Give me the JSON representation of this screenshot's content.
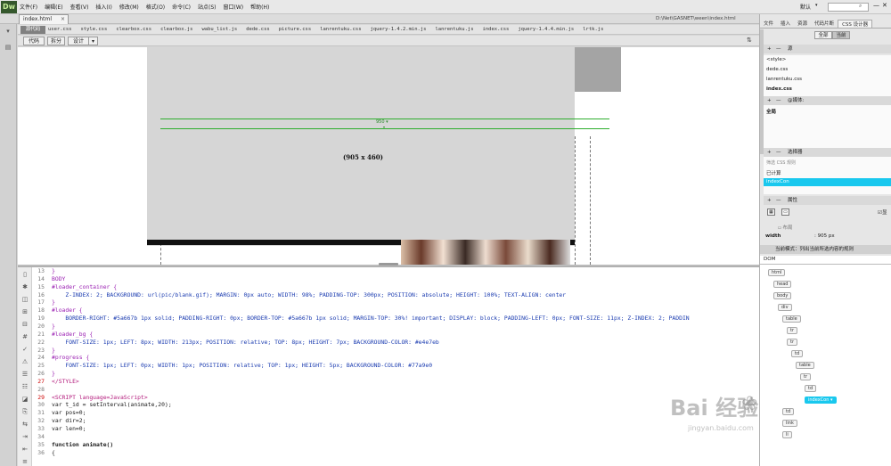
{
  "app": {
    "logo": "Dw",
    "menu": [
      "文件(F)",
      "编辑(E)",
      "查看(V)",
      "插入(I)",
      "修改(M)",
      "格式(O)",
      "命令(C)",
      "站点(S)",
      "窗口(W)",
      "帮助(H)"
    ],
    "workspace": "默认",
    "minimize": "—",
    "close": "✕"
  },
  "document": {
    "tab_name": "index.html",
    "tab_close": "×",
    "path": "D:\\Net\\GASNET\\ween\\index.html",
    "source_code_tab": "源代码",
    "related_files": [
      "user.css",
      "style.css",
      "clearbox.css",
      "clearbox.js",
      "wabu_list.js",
      "dede.css",
      "picture.css",
      "lanrentuku.css",
      "jquery-1.4.2.min.js",
      "lanrentuku.js",
      "index.css",
      "jquery-1.4.4.min.js",
      "lrtk.js"
    ],
    "view_buttons": {
      "code": "代码",
      "split": "拆分",
      "design": "设计",
      "design_drop": "▾"
    },
    "icons": {
      "filter": "filter-icon",
      "toolbar_right": "sort-icon"
    }
  },
  "design_view": {
    "width_guide_label": "950 ▾",
    "width_guide_tick": "▾",
    "size_label": "(905 x 460)"
  },
  "code": {
    "lines": [
      {
        "num": "13",
        "text": "}",
        "cls": "t-css"
      },
      {
        "num": "14",
        "text": "BODY",
        "cls": "t-css"
      },
      {
        "num": "15",
        "text": "#loader_container {",
        "cls": "t-css"
      },
      {
        "num": "16",
        "text": "    Z-INDEX: 2; BACKGROUND: url(pic/blank.gif); MARGIN: 0px auto; WIDTH: 98%; PADDING-TOP: 300px; POSITION: absolute; HEIGHT: 100%; TEXT-ALIGN: center",
        "cls": "t-prop"
      },
      {
        "num": "17",
        "text": "}",
        "cls": "t-css"
      },
      {
        "num": "18",
        "text": "#loader {",
        "cls": "t-css"
      },
      {
        "num": "19",
        "text": "    BORDER-RIGHT: #5a667b 1px solid; PADDING-RIGHT: 0px; BORDER-TOP: #5a667b 1px solid; MARGIN-TOP: 30%! important; DISPLAY: block; PADDING-LEFT: 0px; FONT-SIZE: 11px; Z-INDEX: 2; PADDIN",
        "cls": "t-prop"
      },
      {
        "num": "20",
        "text": "}",
        "cls": "t-css"
      },
      {
        "num": "21",
        "text": "#loader_bg {",
        "cls": "t-css"
      },
      {
        "num": "22",
        "text": "    FONT-SIZE: 1px; LEFT: 8px; WIDTH: 213px; POSITION: relative; TOP: 8px; HEIGHT: 7px; BACKGROUND-COLOR: #e4e7eb",
        "cls": "t-prop"
      },
      {
        "num": "23",
        "text": "}",
        "cls": "t-css"
      },
      {
        "num": "24",
        "text": "#progress {",
        "cls": "t-css"
      },
      {
        "num": "25",
        "text": "    FONT-SIZE: 1px; LEFT: 0px; WIDTH: 1px; POSITION: relative; TOP: 1px; HEIGHT: 5px; BACKGROUND-COLOR: #77a9e0",
        "cls": "t-prop"
      },
      {
        "num": "26",
        "text": "}",
        "cls": "t-css"
      },
      {
        "num": "27",
        "text": "</STYLE>",
        "cls": "t-tag"
      },
      {
        "num": "28",
        "text": "",
        "cls": "t-js"
      },
      {
        "num": "29",
        "text": "<SCRIPT language=JavaScript>",
        "cls": "t-tag"
      },
      {
        "num": "30",
        "text": "var t_id = setInterval(animate,20);",
        "cls": "t-js"
      },
      {
        "num": "31",
        "text": "var pos=0;",
        "cls": "t-js"
      },
      {
        "num": "32",
        "text": "var dir=2;",
        "cls": "t-js"
      },
      {
        "num": "33",
        "text": "var len=0;",
        "cls": "t-js"
      },
      {
        "num": "34",
        "text": "",
        "cls": "t-js"
      },
      {
        "num": "35",
        "text": "function animate()",
        "cls": "t-fn"
      },
      {
        "num": "36",
        "text": "{",
        "cls": "t-js"
      }
    ]
  },
  "panel": {
    "tabs": [
      "文件",
      "插入",
      "资源",
      "代码片断",
      "CSS 设计器"
    ],
    "subtabs": {
      "all": "全部",
      "current": "当前"
    },
    "sources_header": "源",
    "sources": [
      "<style>",
      "dede.css",
      "lanrentuku.css",
      "index.css"
    ],
    "media_header": "@媒体:",
    "media_all": "全局",
    "selector_header": "选择器",
    "filter_placeholder": "筛选 CSS 规则",
    "computed": "已计算",
    "selected_selector": "indexCon",
    "properties_header": "属性",
    "show_set": "显",
    "layout_label": "布局",
    "width_prop": "width",
    "width_val": ":   905 px",
    "current_mode": "当前模式：列出当前所选内容的规则",
    "dom_tab": "DOM",
    "dom_nodes": [
      "html",
      "head",
      "body",
      "div",
      "table",
      "tr",
      "tr",
      "td",
      "table",
      "tr",
      "td",
      "indexCon ▾",
      "td",
      "link",
      "li"
    ]
  },
  "watermark": {
    "logo": "Bai  经验",
    "paw": "❀",
    "url": "jingyan.baidu.com"
  },
  "colors": {
    "accent": "#19c8ee",
    "guide": "#2eae2e",
    "logo_bg": "#35582d"
  }
}
